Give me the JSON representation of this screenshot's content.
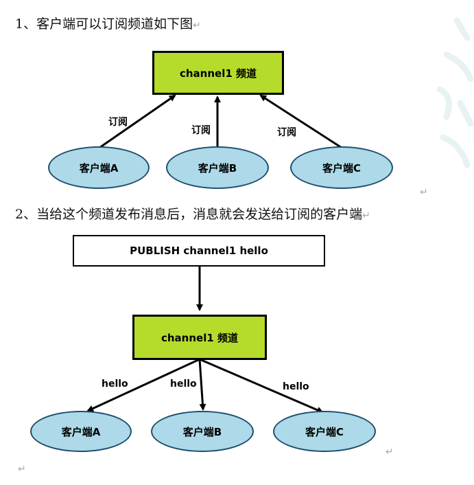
{
  "section1": {
    "heading": "1、客户端可以订阅频道如下图",
    "channel_label": "channel1 频道",
    "edge_label": "订阅",
    "clients": [
      "客户端A",
      "客户端B",
      "客户端C"
    ]
  },
  "section2": {
    "heading": "2、当给这个频道发布消息后，消息就会发送给订阅的客户端",
    "publish_label": "PUBLISH channel1 hello",
    "channel_label": "channel1 频道",
    "edge_label": "hello",
    "clients": [
      "客户端A",
      "客户端B",
      "客户端C"
    ]
  },
  "paragraph_mark": "↵",
  "colors": {
    "channel_fill": "#b5dc2a",
    "client_fill": "#add9e8",
    "client_border": "#1d4e6e"
  }
}
